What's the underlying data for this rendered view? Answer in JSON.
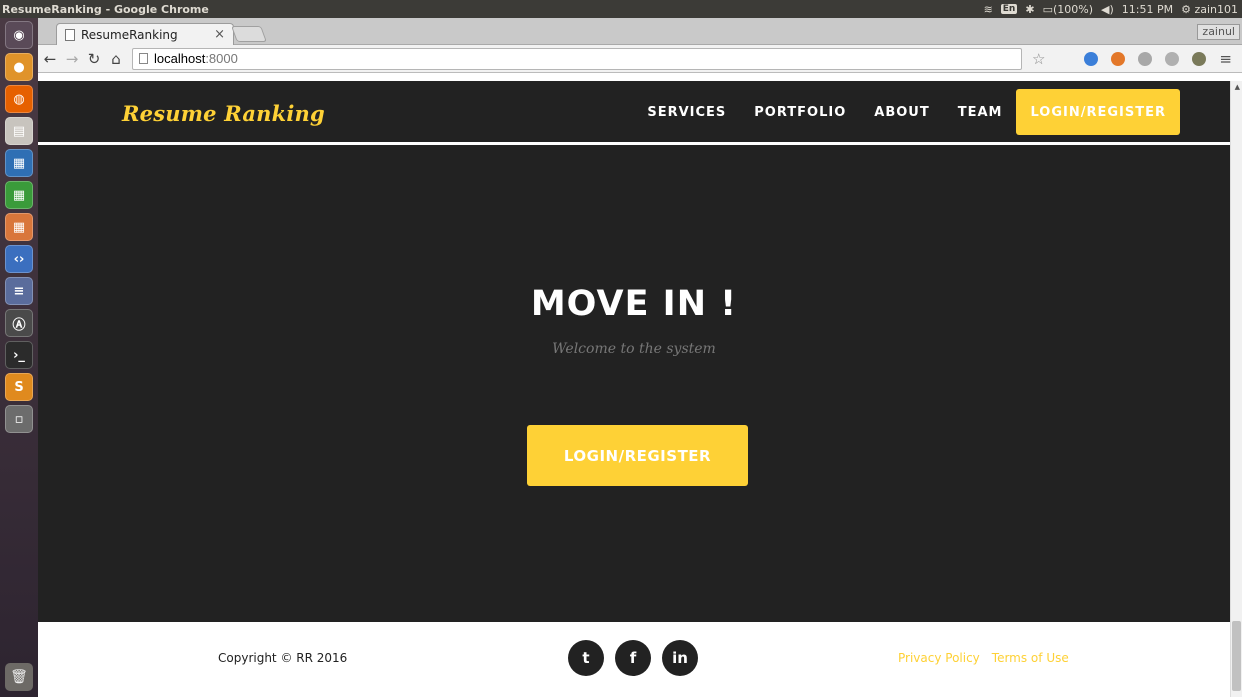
{
  "os": {
    "window_title": "ResumeRanking - Google Chrome",
    "keyboard": "En",
    "battery": "(100%)",
    "clock": "11:51 PM",
    "user": "zain101"
  },
  "browser": {
    "tab_title": "ResumeRanking",
    "tab_close": "×",
    "profile_name": "zainul",
    "url_host": "localhost",
    "url_port": ":8000"
  },
  "site": {
    "brand": "Resume Ranking",
    "nav": [
      "SERVICES",
      "PORTFOLIO",
      "ABOUT",
      "TEAM"
    ],
    "nav_cta": "LOGIN/REGISTER",
    "hero_title": "MOVE IN !",
    "hero_subtitle": "Welcome to the system",
    "hero_button": "LOGIN/REGISTER",
    "footer": {
      "copyright": "Copyright © RR 2016",
      "socials": [
        "twitter-icon",
        "facebook-icon",
        "linkedin-icon"
      ],
      "links": [
        "Privacy Policy",
        "Terms of Use"
      ]
    },
    "colors": {
      "accent": "#fed136",
      "background": "#222222"
    }
  }
}
